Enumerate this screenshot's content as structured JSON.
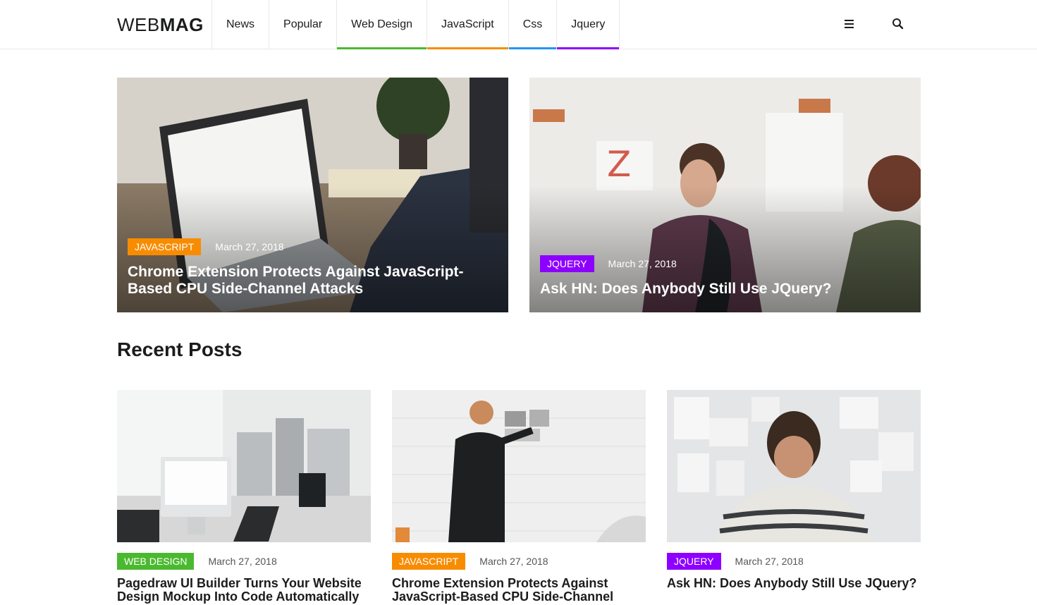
{
  "brand": {
    "logo_light": "WEB",
    "logo_bold": "MAG"
  },
  "nav": {
    "items": [
      {
        "label": "News",
        "underline": ""
      },
      {
        "label": "Popular",
        "underline": ""
      },
      {
        "label": "Web Design",
        "underline": "#4bb92f"
      },
      {
        "label": "JavaScript",
        "underline": "#f88c00"
      },
      {
        "label": "Css",
        "underline": "#2196f3"
      },
      {
        "label": "Jquery",
        "underline": "#8d00ff"
      }
    ],
    "menu_icon": "hamburger-menu-icon",
    "search_icon": "search-icon"
  },
  "colors": {
    "web_design": "#4bb92f",
    "javascript": "#f88c00",
    "css": "#2196f3",
    "jquery": "#8d00ff"
  },
  "featured": [
    {
      "category": "JavaScript",
      "date": "March 27, 2018",
      "title": "Chrome Extension Protects Against JavaScript-Based CPU Side-Channel Attacks"
    },
    {
      "category": "Jquery",
      "date": "March 27, 2018",
      "title": "Ask HN: Does Anybody Still Use JQuery?"
    }
  ],
  "recent": {
    "heading": "Recent Posts",
    "posts": [
      {
        "category": "Web Design",
        "date": "March 27, 2018",
        "title": "Pagedraw UI Builder Turns Your Website Design Mockup Into Code Automatically"
      },
      {
        "category": "JavaScript",
        "date": "March 27, 2018",
        "title": "Chrome Extension Protects Against JavaScript-Based CPU Side-Channel"
      },
      {
        "category": "Jquery",
        "date": "March 27, 2018",
        "title": "Ask HN: Does Anybody Still Use JQuery?"
      }
    ]
  }
}
